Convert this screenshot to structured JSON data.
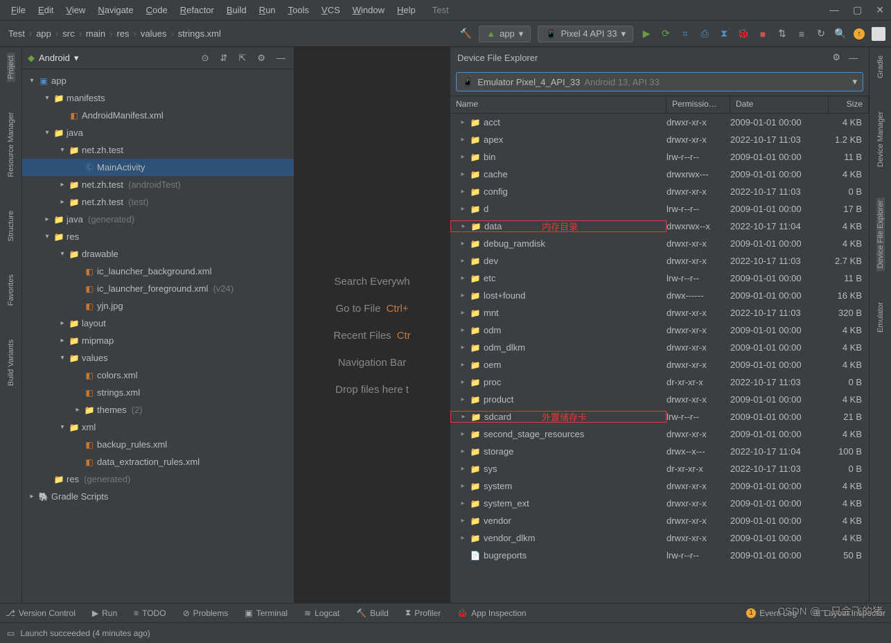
{
  "menu": {
    "items": [
      "File",
      "Edit",
      "View",
      "Navigate",
      "Code",
      "Refactor",
      "Build",
      "Run",
      "Tools",
      "VCS",
      "Window",
      "Help"
    ],
    "project": "Test"
  },
  "breadcrumbs": [
    "Test",
    "app",
    "src",
    "main",
    "res",
    "values",
    "strings.xml"
  ],
  "run_config": {
    "label": "app"
  },
  "device": {
    "label": "Pixel 4 API 33"
  },
  "left_rail": [
    "Project",
    "Resource Manager",
    "Structure",
    "Favorites",
    "Build Variants"
  ],
  "right_rail": [
    "Gradle",
    "Device Manager",
    "Device File Explorer",
    "Emulator"
  ],
  "project_panel": {
    "title": "Android",
    "tree": [
      {
        "d": 0,
        "tw": "▾",
        "ic": "mod",
        "t": "app"
      },
      {
        "d": 1,
        "tw": "▾",
        "ic": "folder",
        "t": "manifests"
      },
      {
        "d": 2,
        "tw": "",
        "ic": "xml",
        "t": "AndroidManifest.xml"
      },
      {
        "d": 1,
        "tw": "▾",
        "ic": "folder",
        "t": "java"
      },
      {
        "d": 2,
        "tw": "▾",
        "ic": "folder",
        "t": "net.zh.test"
      },
      {
        "d": 3,
        "tw": "",
        "ic": "cls",
        "t": "MainActivity",
        "sel": true
      },
      {
        "d": 2,
        "tw": "▸",
        "ic": "folder",
        "t": "net.zh.test",
        "aux": "(androidTest)"
      },
      {
        "d": 2,
        "tw": "▸",
        "ic": "folder",
        "t": "net.zh.test",
        "aux": "(test)"
      },
      {
        "d": 1,
        "tw": "▸",
        "ic": "folder",
        "t": "java",
        "aux": "(generated)"
      },
      {
        "d": 1,
        "tw": "▾",
        "ic": "folder",
        "t": "res"
      },
      {
        "d": 2,
        "tw": "▾",
        "ic": "folder",
        "t": "drawable"
      },
      {
        "d": 3,
        "tw": "",
        "ic": "xml",
        "t": "ic_launcher_background.xml"
      },
      {
        "d": 3,
        "tw": "",
        "ic": "xml",
        "t": "ic_launcher_foreground.xml",
        "aux": "(v24)"
      },
      {
        "d": 3,
        "tw": "",
        "ic": "xml",
        "t": "yjn.jpg"
      },
      {
        "d": 2,
        "tw": "▸",
        "ic": "folder",
        "t": "layout"
      },
      {
        "d": 2,
        "tw": "▸",
        "ic": "folder",
        "t": "mipmap"
      },
      {
        "d": 2,
        "tw": "▾",
        "ic": "folder",
        "t": "values"
      },
      {
        "d": 3,
        "tw": "",
        "ic": "xml",
        "t": "colors.xml"
      },
      {
        "d": 3,
        "tw": "",
        "ic": "xml",
        "t": "strings.xml"
      },
      {
        "d": 3,
        "tw": "▸",
        "ic": "folder",
        "t": "themes",
        "aux": "(2)"
      },
      {
        "d": 2,
        "tw": "▾",
        "ic": "folder",
        "t": "xml"
      },
      {
        "d": 3,
        "tw": "",
        "ic": "xml",
        "t": "backup_rules.xml"
      },
      {
        "d": 3,
        "tw": "",
        "ic": "xml",
        "t": "data_extraction_rules.xml"
      },
      {
        "d": 1,
        "tw": "",
        "ic": "folder",
        "t": "res",
        "aux": "(generated)"
      },
      {
        "d": 0,
        "tw": "▸",
        "ic": "gradle",
        "t": "Gradle Scripts"
      }
    ]
  },
  "editor_tips": [
    {
      "t": "Search Everywh"
    },
    {
      "t": "Go to File",
      "s": "Ctrl+"
    },
    {
      "t": "Recent Files",
      "s": "Ctr"
    },
    {
      "t": "Navigation Bar"
    },
    {
      "t": "Drop files here t"
    }
  ],
  "dfe": {
    "title": "Device File Explorer",
    "selector": {
      "name": "Emulator Pixel_4_API_33",
      "info": "Android 13, API 33"
    },
    "cols": {
      "name": "Name",
      "perm": "Permissio…",
      "date": "Date",
      "size": "Size"
    },
    "rows": [
      {
        "n": "acct",
        "p": "drwxr-xr-x",
        "d": "2009-01-01 00:00",
        "s": "4 KB"
      },
      {
        "n": "apex",
        "p": "drwxr-xr-x",
        "d": "2022-10-17 11:03",
        "s": "1.2 KB"
      },
      {
        "n": "bin",
        "p": "lrw-r--r--",
        "d": "2009-01-01 00:00",
        "s": "11 B"
      },
      {
        "n": "cache",
        "p": "drwxrwx---",
        "d": "2009-01-01 00:00",
        "s": "4 KB"
      },
      {
        "n": "config",
        "p": "drwxr-xr-x",
        "d": "2022-10-17 11:03",
        "s": "0 B"
      },
      {
        "n": "d",
        "p": "lrw-r--r--",
        "d": "2009-01-01 00:00",
        "s": "17 B"
      },
      {
        "n": "data",
        "p": "drwxrwx--x",
        "d": "2022-10-17 11:04",
        "s": "4 KB",
        "red": true,
        "ann": "内存目录"
      },
      {
        "n": "debug_ramdisk",
        "p": "drwxr-xr-x",
        "d": "2009-01-01 00:00",
        "s": "4 KB"
      },
      {
        "n": "dev",
        "p": "drwxr-xr-x",
        "d": "2022-10-17 11:03",
        "s": "2.7 KB"
      },
      {
        "n": "etc",
        "p": "lrw-r--r--",
        "d": "2009-01-01 00:00",
        "s": "11 B"
      },
      {
        "n": "lost+found",
        "p": "drwx------",
        "d": "2009-01-01 00:00",
        "s": "16 KB"
      },
      {
        "n": "mnt",
        "p": "drwxr-xr-x",
        "d": "2022-10-17 11:03",
        "s": "320 B"
      },
      {
        "n": "odm",
        "p": "drwxr-xr-x",
        "d": "2009-01-01 00:00",
        "s": "4 KB"
      },
      {
        "n": "odm_dlkm",
        "p": "drwxr-xr-x",
        "d": "2009-01-01 00:00",
        "s": "4 KB"
      },
      {
        "n": "oem",
        "p": "drwxr-xr-x",
        "d": "2009-01-01 00:00",
        "s": "4 KB"
      },
      {
        "n": "proc",
        "p": "dr-xr-xr-x",
        "d": "2022-10-17 11:03",
        "s": "0 B"
      },
      {
        "n": "product",
        "p": "drwxr-xr-x",
        "d": "2009-01-01 00:00",
        "s": "4 KB"
      },
      {
        "n": "sdcard",
        "p": "lrw-r--r--",
        "d": "2009-01-01 00:00",
        "s": "21 B",
        "red": true,
        "ann": "外置储存卡"
      },
      {
        "n": "second_stage_resources",
        "p": "drwxr-xr-x",
        "d": "2009-01-01 00:00",
        "s": "4 KB"
      },
      {
        "n": "storage",
        "p": "drwx--x---",
        "d": "2022-10-17 11:04",
        "s": "100 B"
      },
      {
        "n": "sys",
        "p": "dr-xr-xr-x",
        "d": "2022-10-17 11:03",
        "s": "0 B"
      },
      {
        "n": "system",
        "p": "drwxr-xr-x",
        "d": "2009-01-01 00:00",
        "s": "4 KB"
      },
      {
        "n": "system_ext",
        "p": "drwxr-xr-x",
        "d": "2009-01-01 00:00",
        "s": "4 KB"
      },
      {
        "n": "vendor",
        "p": "drwxr-xr-x",
        "d": "2009-01-01 00:00",
        "s": "4 KB"
      },
      {
        "n": "vendor_dlkm",
        "p": "drwxr-xr-x",
        "d": "2009-01-01 00:00",
        "s": "4 KB"
      },
      {
        "n": "bugreports",
        "p": "lrw-r--r--",
        "d": "2009-01-01 00:00",
        "s": "50 B",
        "file": true
      }
    ]
  },
  "bottom": {
    "items": [
      "Version Control",
      "Run",
      "TODO",
      "Problems",
      "Terminal",
      "Logcat",
      "Build",
      "Profiler",
      "App Inspection"
    ],
    "event_count": "1",
    "event_label": "Event Log",
    "layout": "Layout Inspector"
  },
  "status": {
    "msg": "Launch succeeded (4 minutes ago)"
  },
  "watermark": "CSDN @一只会飞的猪"
}
